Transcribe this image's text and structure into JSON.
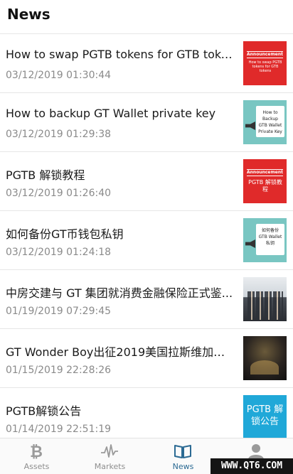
{
  "header": {
    "title": "News"
  },
  "news": [
    {
      "headline": "How to swap PGTB tokens for GTB tokens?",
      "date": "03/12/2019 01:30:44",
      "thumb": {
        "style": "announcement",
        "title": "Announcement",
        "text": "How to swap PGTB tokens for GTB tokens"
      }
    },
    {
      "headline": "How to backup GT Wallet private key",
      "date": "03/12/2019 01:29:38",
      "thumb": {
        "style": "card",
        "text": "How to Backup GTB Wallet Private Key"
      }
    },
    {
      "headline": "PGTB 解锁教程",
      "date": "03/12/2019 01:26:40",
      "thumb": {
        "style": "announcement",
        "title": "Announcement",
        "text": "PGTB 解锁教程"
      }
    },
    {
      "headline": "如何备份GT币钱包私钥",
      "date": "03/12/2019 01:24:18",
      "thumb": {
        "style": "card",
        "text": "如何备份 GTB Wallet 私钥"
      }
    },
    {
      "headline": "中房交建与 GT 集团就消费金融保险正式鉴...",
      "date": "01/19/2019 07:29:45",
      "thumb": {
        "style": "photo"
      }
    },
    {
      "headline": "GT Wonder Boy出征2019美国拉斯维加斯...",
      "date": "01/15/2019 22:28:26",
      "thumb": {
        "style": "dark"
      }
    },
    {
      "headline": "PGTB解锁公告",
      "date": "01/14/2019 22:51:19",
      "thumb": {
        "style": "blue",
        "text": "PGTB 解锁公告"
      }
    }
  ],
  "tabs": [
    {
      "label": "Assets",
      "icon": "bitcoin-icon",
      "active": false
    },
    {
      "label": "Markets",
      "icon": "pulse-chart-icon",
      "active": false
    },
    {
      "label": "News",
      "icon": "open-book-icon",
      "active": true
    },
    {
      "label": "",
      "icon": "person-icon",
      "active": false
    }
  ],
  "watermark": "WWW.QT6.COM",
  "colors": {
    "active_tab": "#2b6a93",
    "inactive_tab": "#8e8e8e",
    "announcement_red": "#e02a2a",
    "teal": "#79c6c2",
    "blue": "#20a8d8"
  }
}
